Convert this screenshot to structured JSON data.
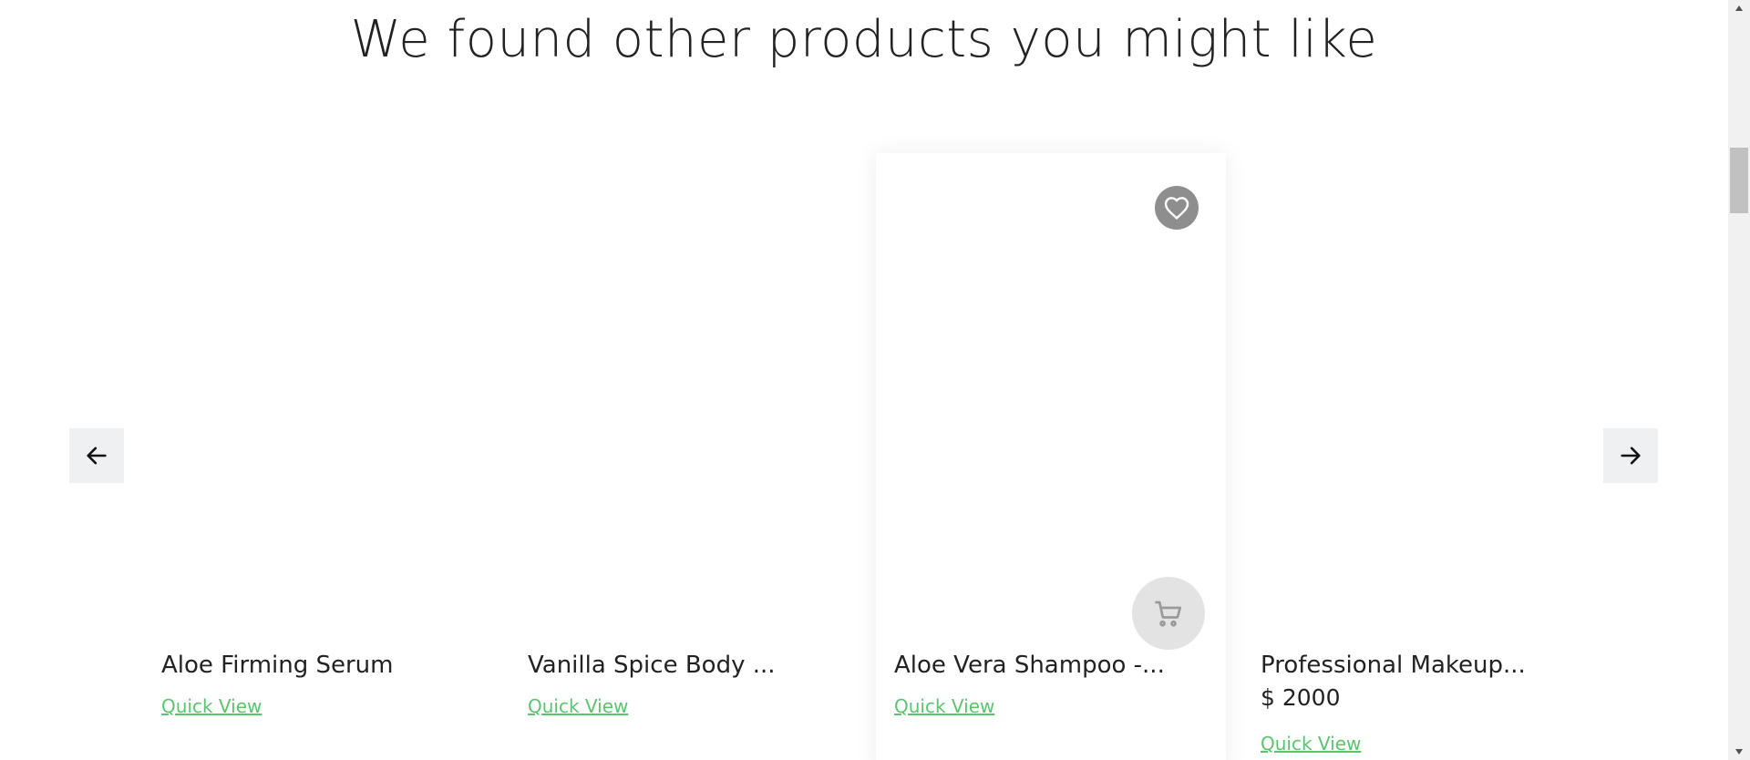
{
  "section": {
    "title": "We found other products you might like"
  },
  "carousel": {
    "prev_icon": "arrow-left-icon",
    "next_icon": "arrow-right-icon",
    "products": [
      {
        "name": "Aloe Firming Serum",
        "price": "",
        "quick_view": "Quick View"
      },
      {
        "name": "Vanilla Spice Body ...",
        "price": "",
        "quick_view": "Quick View"
      },
      {
        "name": "Aloe Vera Shampoo -...",
        "price": "",
        "quick_view": "Quick View",
        "wishlist_icon": "heart-icon",
        "cart_icon": "cart-icon"
      },
      {
        "name": "Professional Makeup...",
        "price": "$ 2000",
        "quick_view": "Quick View"
      }
    ]
  },
  "colors": {
    "link": "#5cc46f",
    "arrow_bg": "#eef0f2",
    "wishlist_bg": "#8e8e8e",
    "cart_bg": "#e3e3e3"
  }
}
